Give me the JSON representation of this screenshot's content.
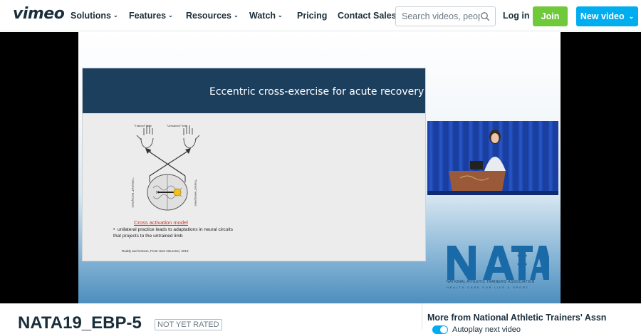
{
  "header": {
    "logo": "vimeo",
    "nav": [
      {
        "label": "Solutions",
        "dropdown": true
      },
      {
        "label": "Features",
        "dropdown": true
      },
      {
        "label": "Resources",
        "dropdown": true
      },
      {
        "label": "Watch",
        "dropdown": true
      },
      {
        "label": "Pricing",
        "dropdown": false
      },
      {
        "label": "Contact Sales",
        "dropdown": false
      }
    ],
    "search_placeholder": "Search videos, people",
    "login_label": "Log in",
    "join_label": "Join",
    "new_video_label": "New video"
  },
  "colors": {
    "join": "#6fc93a",
    "new_video": "#00adef",
    "slide_header": "#1c3f5e",
    "text": "#1a2e3b"
  },
  "slide": {
    "title": "Eccentric cross-exercise for acute recovery",
    "trained_label": "\"Trained\" limb",
    "untrained_label": "\"Untrained\" limb",
    "left_hemi_label": "\"Untrained\" hemisphere",
    "right_hemi_label": "\"Trained\" hemisphere",
    "caption": "Cross activation model",
    "bullet": "unilateral practice leads to adaptations in neural circuits that projects to the untrained limb",
    "citation": "Ruddy and Carson, Front Hum NeuroSci, 2013"
  },
  "logo_overlay": {
    "acronym": "NATA",
    "name": "NATIONAL ATHLETIC TRAINERS' ASSOCIATION",
    "tagline": "HEALTH CARE FOR LIFE & SPORT"
  },
  "video": {
    "title": "NATA19_EBP-5",
    "rating": "NOT YET RATED"
  },
  "sidebar": {
    "more_from": "More from National Athletic Trainers' Assn",
    "autoplay_label": "Autoplay next video"
  }
}
